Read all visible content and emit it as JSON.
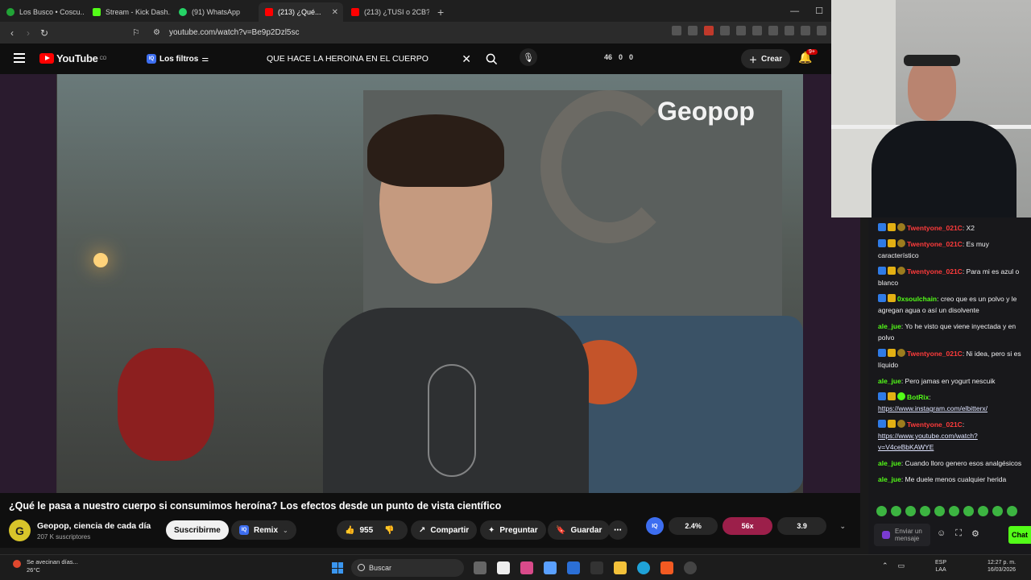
{
  "browser": {
    "tabs": [
      {
        "label": "Los Busco • Coscu...",
        "favicon_color": "#21a336"
      },
      {
        "label": "Stream - Kick Dash...",
        "favicon_color": "#53fc18"
      },
      {
        "label": "(91) WhatsApp",
        "favicon_color": "#25d366"
      },
      {
        "label": "(213) ¿Qué...",
        "favicon_color": "#ff0000",
        "active": true
      },
      {
        "label": "(213) ¿TUSI o 2CB?",
        "favicon_color": "#ff0000"
      }
    ],
    "new_tab": "+",
    "address": "youtube.com/watch?v=Be9p2Dzl5sc"
  },
  "youtube": {
    "logo_text": "YouTube",
    "region": "CO",
    "filters_label": "Los filtros",
    "search_query": "QUE HACE LA HEROINA EN EL CUERPO",
    "stats": [
      "46",
      "0",
      "0"
    ],
    "create_label": "Crear",
    "notif_badge": "9+",
    "video": {
      "brand_overlay": "Geopop",
      "title": "¿Qué le pasa a nuestro cuerpo si consumimos heroína? Los efectos desde un punto de vista científico",
      "channel_name": "Geopop, ciencia de cada día",
      "subscribers": "207 K suscriptores",
      "subscribe_label": "Suscribirme",
      "remix_label": "Remix",
      "likes": "955",
      "share_label": "Compartir",
      "ask_label": "Preguntar",
      "save_label": "Guardar"
    },
    "iq_metrics": {
      "a": "2.4%",
      "b": "56x",
      "c": "3.9"
    }
  },
  "chat": {
    "messages": [
      {
        "user": "Twentyone_021C",
        "color": "red",
        "text": ": X2"
      },
      {
        "user": "Twentyone_021C",
        "color": "red",
        "text": ": Es muy característico"
      },
      {
        "user": "Twentyone_021C",
        "color": "red",
        "text": ": Para mi es azul o blanco"
      },
      {
        "user": "0xsoulchain",
        "color": "green",
        "text": ": creo que es un polvo y le agregan agua o así un disolvente"
      },
      {
        "user": "ale_jue",
        "color": "green",
        "text": ": Yo he visto que viene inyectada y en polvo"
      },
      {
        "user": "Twentyone_021C",
        "color": "red",
        "text": ": Ni idea, pero si es líquido"
      },
      {
        "user": "ale_jue",
        "color": "green",
        "text": ": Pero jamas en yogurt nescuik"
      },
      {
        "user": "BotRix",
        "color": "green",
        "text": ":",
        "link": "https://www.instagram.com/elbitterx/"
      },
      {
        "user": "Twentyone_021C",
        "color": "red",
        "text": ":",
        "link": "https://www.youtube.com/watch?v=V4ceBbKAWYE"
      },
      {
        "user": "ale_jue",
        "color": "green",
        "text": ": Cuando lloro genero esos analgésicos"
      },
      {
        "user": "ale_jue",
        "color": "green",
        "text": ": Me duele menos cualquier herida"
      }
    ],
    "input_placeholder": "Enviar un mensaje",
    "send_label": "Chat"
  },
  "taskbar": {
    "weather_line1": "Se avecinan días...",
    "weather_line2": "26°C",
    "search_label": "Buscar",
    "lang_line1": "ESP",
    "lang_line2": "LAA",
    "time": "12:27 p. m.",
    "date": "16/03/2026"
  }
}
